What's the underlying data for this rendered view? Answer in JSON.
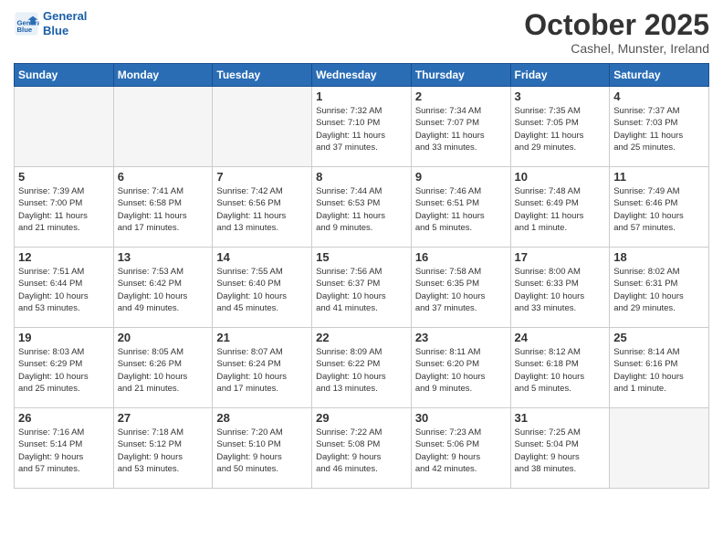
{
  "header": {
    "logo_line1": "General",
    "logo_line2": "Blue",
    "month_title": "October 2025",
    "location": "Cashel, Munster, Ireland"
  },
  "weekdays": [
    "Sunday",
    "Monday",
    "Tuesday",
    "Wednesday",
    "Thursday",
    "Friday",
    "Saturday"
  ],
  "weeks": [
    [
      {
        "day": "",
        "info": ""
      },
      {
        "day": "",
        "info": ""
      },
      {
        "day": "",
        "info": ""
      },
      {
        "day": "1",
        "info": "Sunrise: 7:32 AM\nSunset: 7:10 PM\nDaylight: 11 hours\nand 37 minutes."
      },
      {
        "day": "2",
        "info": "Sunrise: 7:34 AM\nSunset: 7:07 PM\nDaylight: 11 hours\nand 33 minutes."
      },
      {
        "day": "3",
        "info": "Sunrise: 7:35 AM\nSunset: 7:05 PM\nDaylight: 11 hours\nand 29 minutes."
      },
      {
        "day": "4",
        "info": "Sunrise: 7:37 AM\nSunset: 7:03 PM\nDaylight: 11 hours\nand 25 minutes."
      }
    ],
    [
      {
        "day": "5",
        "info": "Sunrise: 7:39 AM\nSunset: 7:00 PM\nDaylight: 11 hours\nand 21 minutes."
      },
      {
        "day": "6",
        "info": "Sunrise: 7:41 AM\nSunset: 6:58 PM\nDaylight: 11 hours\nand 17 minutes."
      },
      {
        "day": "7",
        "info": "Sunrise: 7:42 AM\nSunset: 6:56 PM\nDaylight: 11 hours\nand 13 minutes."
      },
      {
        "day": "8",
        "info": "Sunrise: 7:44 AM\nSunset: 6:53 PM\nDaylight: 11 hours\nand 9 minutes."
      },
      {
        "day": "9",
        "info": "Sunrise: 7:46 AM\nSunset: 6:51 PM\nDaylight: 11 hours\nand 5 minutes."
      },
      {
        "day": "10",
        "info": "Sunrise: 7:48 AM\nSunset: 6:49 PM\nDaylight: 11 hours\nand 1 minute."
      },
      {
        "day": "11",
        "info": "Sunrise: 7:49 AM\nSunset: 6:46 PM\nDaylight: 10 hours\nand 57 minutes."
      }
    ],
    [
      {
        "day": "12",
        "info": "Sunrise: 7:51 AM\nSunset: 6:44 PM\nDaylight: 10 hours\nand 53 minutes."
      },
      {
        "day": "13",
        "info": "Sunrise: 7:53 AM\nSunset: 6:42 PM\nDaylight: 10 hours\nand 49 minutes."
      },
      {
        "day": "14",
        "info": "Sunrise: 7:55 AM\nSunset: 6:40 PM\nDaylight: 10 hours\nand 45 minutes."
      },
      {
        "day": "15",
        "info": "Sunrise: 7:56 AM\nSunset: 6:37 PM\nDaylight: 10 hours\nand 41 minutes."
      },
      {
        "day": "16",
        "info": "Sunrise: 7:58 AM\nSunset: 6:35 PM\nDaylight: 10 hours\nand 37 minutes."
      },
      {
        "day": "17",
        "info": "Sunrise: 8:00 AM\nSunset: 6:33 PM\nDaylight: 10 hours\nand 33 minutes."
      },
      {
        "day": "18",
        "info": "Sunrise: 8:02 AM\nSunset: 6:31 PM\nDaylight: 10 hours\nand 29 minutes."
      }
    ],
    [
      {
        "day": "19",
        "info": "Sunrise: 8:03 AM\nSunset: 6:29 PM\nDaylight: 10 hours\nand 25 minutes."
      },
      {
        "day": "20",
        "info": "Sunrise: 8:05 AM\nSunset: 6:26 PM\nDaylight: 10 hours\nand 21 minutes."
      },
      {
        "day": "21",
        "info": "Sunrise: 8:07 AM\nSunset: 6:24 PM\nDaylight: 10 hours\nand 17 minutes."
      },
      {
        "day": "22",
        "info": "Sunrise: 8:09 AM\nSunset: 6:22 PM\nDaylight: 10 hours\nand 13 minutes."
      },
      {
        "day": "23",
        "info": "Sunrise: 8:11 AM\nSunset: 6:20 PM\nDaylight: 10 hours\nand 9 minutes."
      },
      {
        "day": "24",
        "info": "Sunrise: 8:12 AM\nSunset: 6:18 PM\nDaylight: 10 hours\nand 5 minutes."
      },
      {
        "day": "25",
        "info": "Sunrise: 8:14 AM\nSunset: 6:16 PM\nDaylight: 10 hours\nand 1 minute."
      }
    ],
    [
      {
        "day": "26",
        "info": "Sunrise: 7:16 AM\nSunset: 5:14 PM\nDaylight: 9 hours\nand 57 minutes."
      },
      {
        "day": "27",
        "info": "Sunrise: 7:18 AM\nSunset: 5:12 PM\nDaylight: 9 hours\nand 53 minutes."
      },
      {
        "day": "28",
        "info": "Sunrise: 7:20 AM\nSunset: 5:10 PM\nDaylight: 9 hours\nand 50 minutes."
      },
      {
        "day": "29",
        "info": "Sunrise: 7:22 AM\nSunset: 5:08 PM\nDaylight: 9 hours\nand 46 minutes."
      },
      {
        "day": "30",
        "info": "Sunrise: 7:23 AM\nSunset: 5:06 PM\nDaylight: 9 hours\nand 42 minutes."
      },
      {
        "day": "31",
        "info": "Sunrise: 7:25 AM\nSunset: 5:04 PM\nDaylight: 9 hours\nand 38 minutes."
      },
      {
        "day": "",
        "info": ""
      }
    ]
  ]
}
